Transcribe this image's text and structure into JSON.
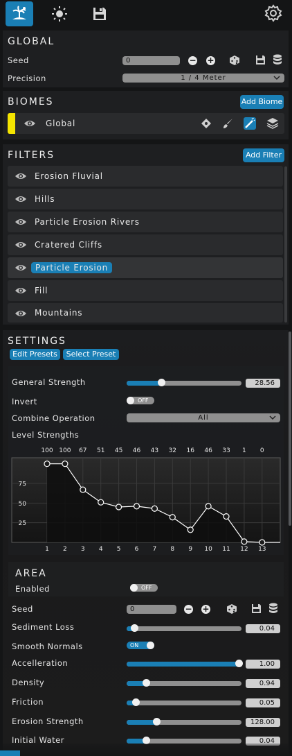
{
  "top_tabs": [
    {
      "icon": "island-icon",
      "active": true
    },
    {
      "icon": "sun-icon",
      "active": false
    },
    {
      "icon": "save-icon",
      "active": false
    }
  ],
  "settings_icon": "gear-icon",
  "global": {
    "header": "GLOBAL",
    "seed_label": "Seed",
    "seed_value": "0",
    "precision_label": "Precision",
    "precision_value": "1 / 4 Meter"
  },
  "biomes": {
    "header": "BIOMES",
    "add_label": "Add Biome",
    "items": [
      {
        "label": "Global",
        "color": "#f4e400"
      }
    ]
  },
  "filters": {
    "header": "FILTERS",
    "add_label": "Add Filter",
    "items": [
      {
        "label": "Erosion Fluvial"
      },
      {
        "label": "Hills"
      },
      {
        "label": "Particle Erosion Rivers"
      },
      {
        "label": "Cratered Cliffs"
      },
      {
        "label": "Particle Erosion",
        "selected": true
      },
      {
        "label": "Fill"
      },
      {
        "label": "Mountains"
      }
    ]
  },
  "settings": {
    "header": "SETTINGS",
    "edit_presets": "Edit Presets",
    "select_preset": "Select Preset",
    "general_strength_label": "General Strength",
    "general_strength_value": "28.56",
    "general_strength_fraction": 0.2856,
    "invert_label": "Invert",
    "invert_state": "OFF",
    "combine_label": "Combine Operation",
    "combine_value": "All",
    "level_label": "Level Strengths"
  },
  "chart_data": {
    "type": "line",
    "x": [
      1,
      2,
      3,
      4,
      5,
      6,
      7,
      8,
      9,
      10,
      11,
      12,
      13
    ],
    "values": [
      100,
      100,
      67,
      51,
      45,
      46,
      43,
      32,
      16,
      46,
      33,
      1,
      0
    ],
    "value_labels": [
      "100",
      "100",
      "67",
      "51",
      "45",
      "46",
      "43",
      "32",
      "16",
      "46",
      "33",
      "1",
      "0"
    ],
    "yticks": [
      "75",
      "50",
      "25"
    ],
    "ytick_values": [
      75,
      50,
      25
    ],
    "xticks": [
      "1",
      "2",
      "3",
      "4",
      "5",
      "6",
      "7",
      "8",
      "9",
      "10",
      "11",
      "12",
      "13"
    ],
    "ylim": [
      0,
      105
    ],
    "grid": true
  },
  "area": {
    "header": "AREA",
    "enabled_label": "Enabled",
    "enabled_state": "OFF"
  },
  "params": {
    "seed_label": "Seed",
    "seed_value": "0",
    "sediment_label": "Sediment Loss",
    "sediment_value": "0.04",
    "sediment_fraction": 0.04,
    "smooth_label": "Smooth Normals",
    "smooth_state": "ON",
    "accel_label": "Accelleration",
    "accel_value": "1.00",
    "accel_fraction": 1.0,
    "density_label": "Density",
    "density_value": "0.94",
    "density_fraction": 0.17,
    "friction_label": "Friction",
    "friction_value": "0.05",
    "friction_fraction": 0.05,
    "erosion_label": "Erosion Strength",
    "erosion_value": "128.00",
    "erosion_fraction": 0.26,
    "water_label": "Initial Water",
    "water_value": "0.04",
    "water_fraction": 0.17
  },
  "colors": {
    "accent": "#1a7fb5",
    "biome_yellow": "#f4e400",
    "background": "#141516"
  }
}
